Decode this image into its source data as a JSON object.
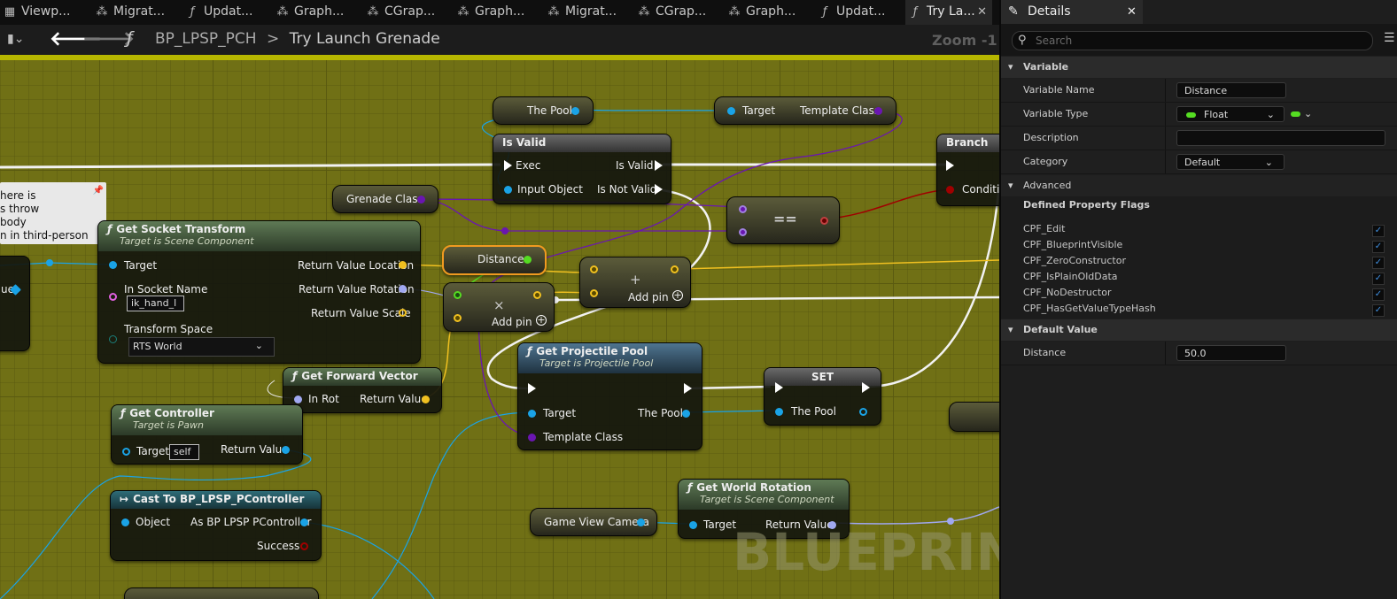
{
  "tabs": [
    {
      "label": "Viewp...",
      "icon": "viewport-icon"
    },
    {
      "label": "Migrat...",
      "icon": "graph-icon"
    },
    {
      "label": "Updat...",
      "icon": "function-icon"
    },
    {
      "label": "Graph...",
      "icon": "graph-icon"
    },
    {
      "label": "CGrap...",
      "icon": "graph-icon"
    },
    {
      "label": "Graph...",
      "icon": "graph-icon"
    },
    {
      "label": "Migrat...",
      "icon": "graph-icon"
    },
    {
      "label": "CGrap...",
      "icon": "graph-icon"
    },
    {
      "label": "Graph...",
      "icon": "graph-icon"
    },
    {
      "label": "Updat...",
      "icon": "function-icon"
    },
    {
      "label": "Try La...",
      "icon": "function-icon"
    }
  ],
  "breadcrumb": {
    "blueprint": "BP_LPSP_PCH",
    "separator": ">",
    "function": "Try Launch Grenade",
    "zoom": "Zoom -1"
  },
  "comment_lines": [
    "here is",
    "s throw",
    "body",
    "n in third-person"
  ],
  "nodes": {
    "the_pool_get": {
      "label": "The Pool"
    },
    "template_class_get": {
      "target": "Target",
      "output": "Template Class"
    },
    "is_valid": {
      "title": "Is Valid",
      "exec": "Exec",
      "input": "Input Object",
      "out_valid": "Is Valid",
      "out_not_valid": "Is Not Valid"
    },
    "branch": {
      "title": "Branch",
      "condition": "Conditio"
    },
    "grenade_class": {
      "label": "Grenade Class"
    },
    "equals": {
      "label": "=="
    },
    "socket_transform": {
      "title": "Get Socket Transform",
      "subtitle": "Target is Scene Component",
      "target": "Target",
      "socket_name_label": "In Socket Name",
      "socket_name_value": "ik_hand_l",
      "transform_space_label": "Transform Space",
      "transform_space_value": "RTS World",
      "out_location": "Return Value Location",
      "out_rotation": "Return Value Rotation",
      "out_scale": "Return Value Scale"
    },
    "distance_get": {
      "label": "Distance"
    },
    "multiply": {
      "symbol": "×",
      "add_pin": "Add pin"
    },
    "add": {
      "symbol": "+",
      "add_pin": "Add pin"
    },
    "forward_vector": {
      "title": "Get Forward Vector",
      "in": "In Rot",
      "out": "Return Value"
    },
    "get_projectile_pool": {
      "title": "Get Projectile Pool",
      "subtitle": "Target is Projectile Pool",
      "target": "Target",
      "template": "Template Class",
      "out": "The Pool"
    },
    "set_node": {
      "title": "SET",
      "pin": "The Pool"
    },
    "get_controller": {
      "title": "Get Controller",
      "subtitle": "Target is Pawn",
      "target": "Target",
      "target_value": "self",
      "out": "Return Value"
    },
    "cast": {
      "title": "Cast To BP_LPSP_PController",
      "object": "Object",
      "out": "As BP LPSP PController",
      "success": "Success"
    },
    "camera": {
      "label": "Game View Camera"
    },
    "world_rotation": {
      "title": "Get World Rotation",
      "subtitle": "Target is Scene Component",
      "target": "Target",
      "out": "Return Value"
    },
    "left_stub": {
      "label": "ue"
    }
  },
  "watermark": "BLUEPRINT",
  "details": {
    "tab_label": "Details",
    "search_placeholder": "Search",
    "variable_section": "Variable",
    "variable_name_label": "Variable Name",
    "variable_name_value": "Distance",
    "variable_type_label": "Variable Type",
    "variable_type_value": "Float",
    "description_label": "Description",
    "category_label": "Category",
    "category_value": "Default",
    "advanced_section": "Advanced",
    "flags_heading": "Defined Property Flags",
    "flags": [
      "CPF_Edit",
      "CPF_BlueprintVisible",
      "CPF_ZeroConstructor",
      "CPF_IsPlainOldData",
      "CPF_NoDestructor",
      "CPF_HasGetValueTypeHash"
    ],
    "default_section": "Default Value",
    "default_label": "Distance",
    "default_value": "50.0"
  },
  "colors": {
    "float_pin": "#55dd22",
    "object_pin": "#1aa3e6",
    "class_pin": "#6a16b0",
    "vector_pin": "#f0c020",
    "rotator_pin": "#a0a8f0",
    "bool_pin": "#a00000",
    "transform_pin": "#f08030"
  }
}
